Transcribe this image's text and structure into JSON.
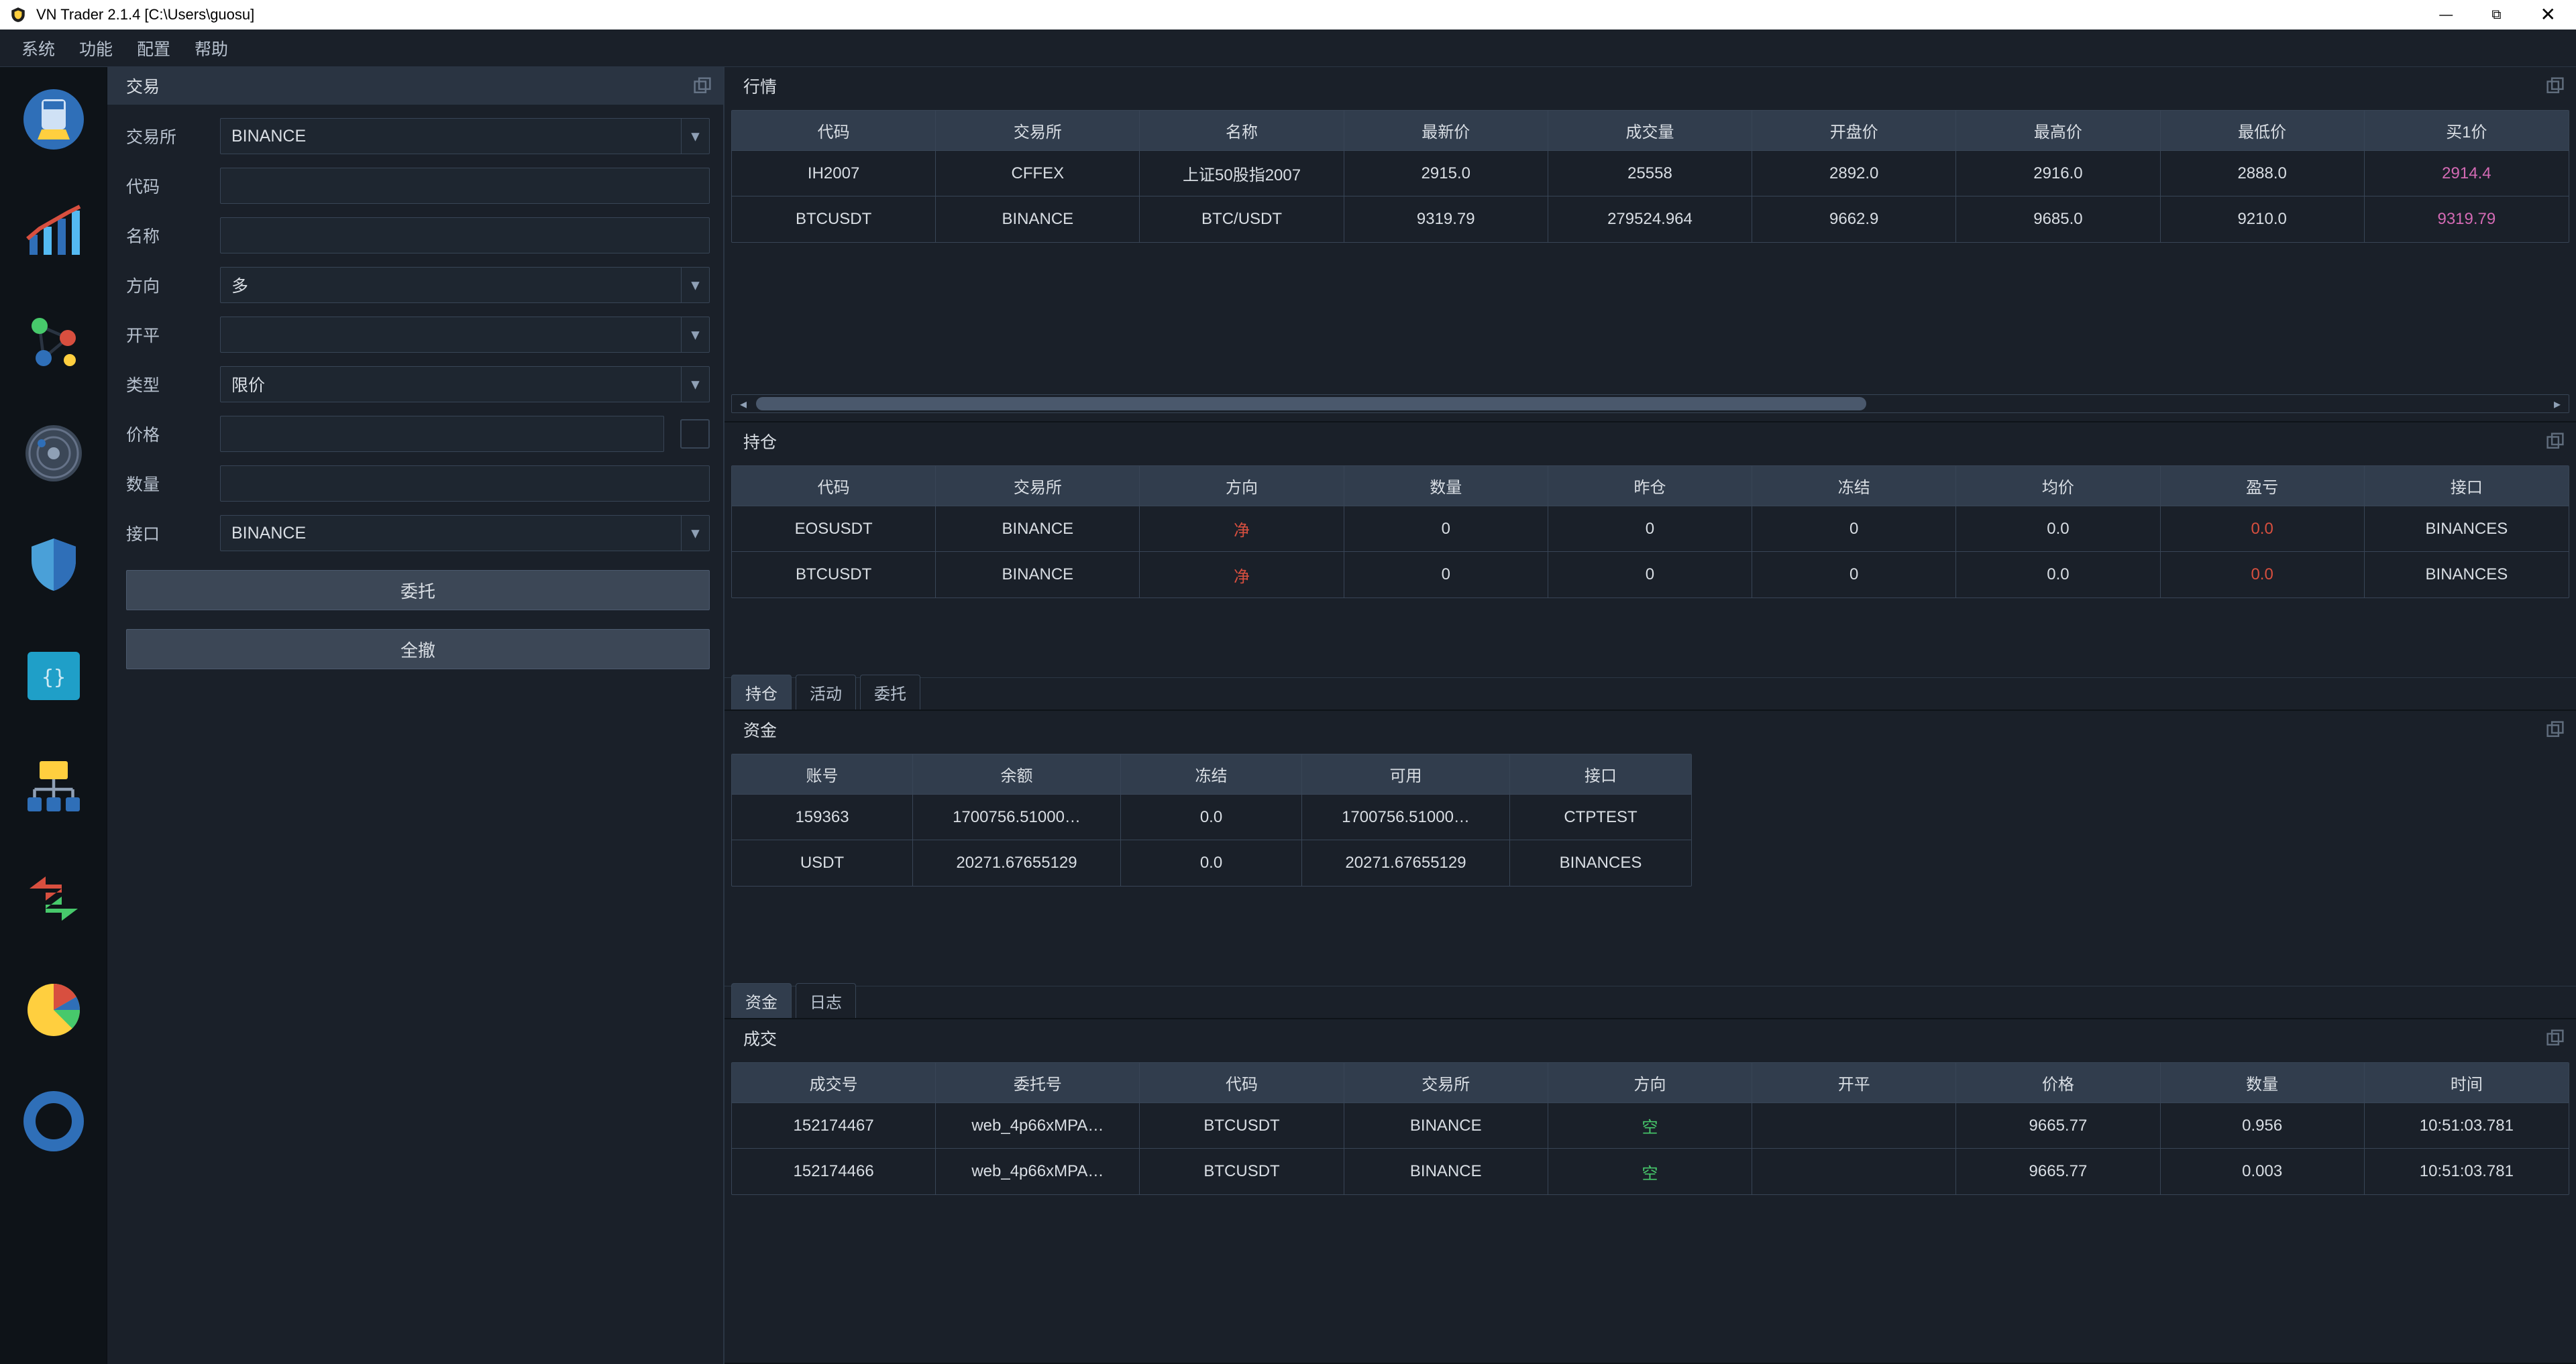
{
  "title": "VN Trader 2.1.4 [C:\\Users\\guosu]",
  "menubar": [
    "系统",
    "功能",
    "配置",
    "帮助"
  ],
  "order_panel": {
    "title": "交易",
    "labels": {
      "exchange": "交易所",
      "symbol": "代码",
      "name": "名称",
      "direction": "方向",
      "offset": "开平",
      "type": "类型",
      "price": "价格",
      "qty": "数量",
      "gateway": "接口"
    },
    "values": {
      "exchange": "BINANCE",
      "symbol": "",
      "name": "",
      "direction": "多",
      "offset": "",
      "type": "限价",
      "price": "",
      "qty": "",
      "gateway": "BINANCE"
    },
    "submit": "委托",
    "cancel_all": "全撤"
  },
  "quotes": {
    "title": "行情",
    "headers": [
      "代码",
      "交易所",
      "名称",
      "最新价",
      "成交量",
      "开盘价",
      "最高价",
      "最低价",
      "买1价"
    ],
    "rows": [
      [
        "IH2007",
        "CFFEX",
        "上证50股指2007",
        "2915.0",
        "25558",
        "2892.0",
        "2916.0",
        "2888.0",
        "2914.4"
      ],
      [
        "BTCUSDT",
        "BINANCE",
        "BTC/USDT",
        "9319.79",
        "279524.964",
        "9662.9",
        "9685.0",
        "9210.0",
        "9319.79"
      ]
    ]
  },
  "positions": {
    "title": "持仓",
    "headers": [
      "代码",
      "交易所",
      "方向",
      "数量",
      "昨仓",
      "冻结",
      "均价",
      "盈亏",
      "接口"
    ],
    "rows": [
      [
        "EOSUSDT",
        "BINANCE",
        "净",
        "0",
        "0",
        "0",
        "0.0",
        "0.0",
        "BINANCES"
      ],
      [
        "BTCUSDT",
        "BINANCE",
        "净",
        "0",
        "0",
        "0",
        "0.0",
        "0.0",
        "BINANCES"
      ]
    ],
    "tabs": [
      "持仓",
      "活动",
      "委托"
    ]
  },
  "accounts": {
    "title": "资金",
    "headers": [
      "账号",
      "余额",
      "冻结",
      "可用",
      "接口"
    ],
    "rows": [
      [
        "159363",
        "1700756.51000…",
        "0.0",
        "1700756.51000…",
        "CTPTEST"
      ],
      [
        "USDT",
        "20271.67655129",
        "0.0",
        "20271.67655129",
        "BINANCES"
      ]
    ],
    "tabs": [
      "资金",
      "日志"
    ]
  },
  "trades": {
    "title": "成交",
    "headers": [
      "成交号",
      "委托号",
      "代码",
      "交易所",
      "方向",
      "开平",
      "价格",
      "数量",
      "时间"
    ],
    "rows": [
      [
        "152174467",
        "web_4p66xMPA…",
        "BTCUSDT",
        "BINANCE",
        "空",
        "",
        "9665.77",
        "0.956",
        "10:51:03.781"
      ],
      [
        "152174466",
        "web_4p66xMPA…",
        "BTCUSDT",
        "BINANCE",
        "空",
        "",
        "9665.77",
        "0.003",
        "10:51:03.781"
      ]
    ]
  }
}
